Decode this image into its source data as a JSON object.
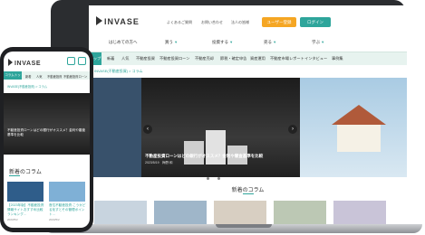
{
  "laptop": {
    "logo": "INVASE",
    "top_links": [
      "よくあるご質問",
      "お問い合わせ",
      "法人の皆様"
    ],
    "cta_primary": "ユーザー登録",
    "cta_login": "ログイン",
    "nav": [
      "はじめての方へ",
      "買う",
      "投資する",
      "売る",
      "学ぶ"
    ],
    "category_active": "トップ",
    "categories": [
      "新着",
      "人気",
      "不動産投資",
      "不動産投資ローン",
      "不動産売却",
      "節税・確定申告",
      "資産運用",
      "不動産市場レポート",
      "インタビュー",
      "事例集"
    ],
    "breadcrumb": "INVASE(不動産投資) > コラム",
    "slide_caption": "不動産投資ローンはどの銀行がオススメ？金利や審査基準を比較",
    "slide_date": "2023/5/19　梅野 和",
    "prev_arrow": "‹",
    "next_arrow": "›",
    "section_title": "新着のコラム",
    "colors": {
      "accent": "#2ea59b",
      "cta": "#f5a623",
      "frame": "#2b2d30"
    }
  },
  "phone": {
    "logo": "INVASE",
    "category_active": "コラムトップ",
    "categories": [
      "新着",
      "人気",
      "不動産投資",
      "不動産投資ローン"
    ],
    "breadcrumb": "INVASE(不動産投資) > コラム",
    "hero_text": "不動産投資ローンはどの銀行がオススメ？金利や審査基準を比較",
    "section_title": "新着のコラム",
    "cards": [
      {
        "title": "【2023年版】不動産投資情報サイトおすすめ比較ランキング…",
        "date": "2023/5/2"
      },
      {
        "title": "首位不動産投資 こうかどる化すとその管理ポイント…",
        "date": "2023/5/2"
      }
    ]
  }
}
